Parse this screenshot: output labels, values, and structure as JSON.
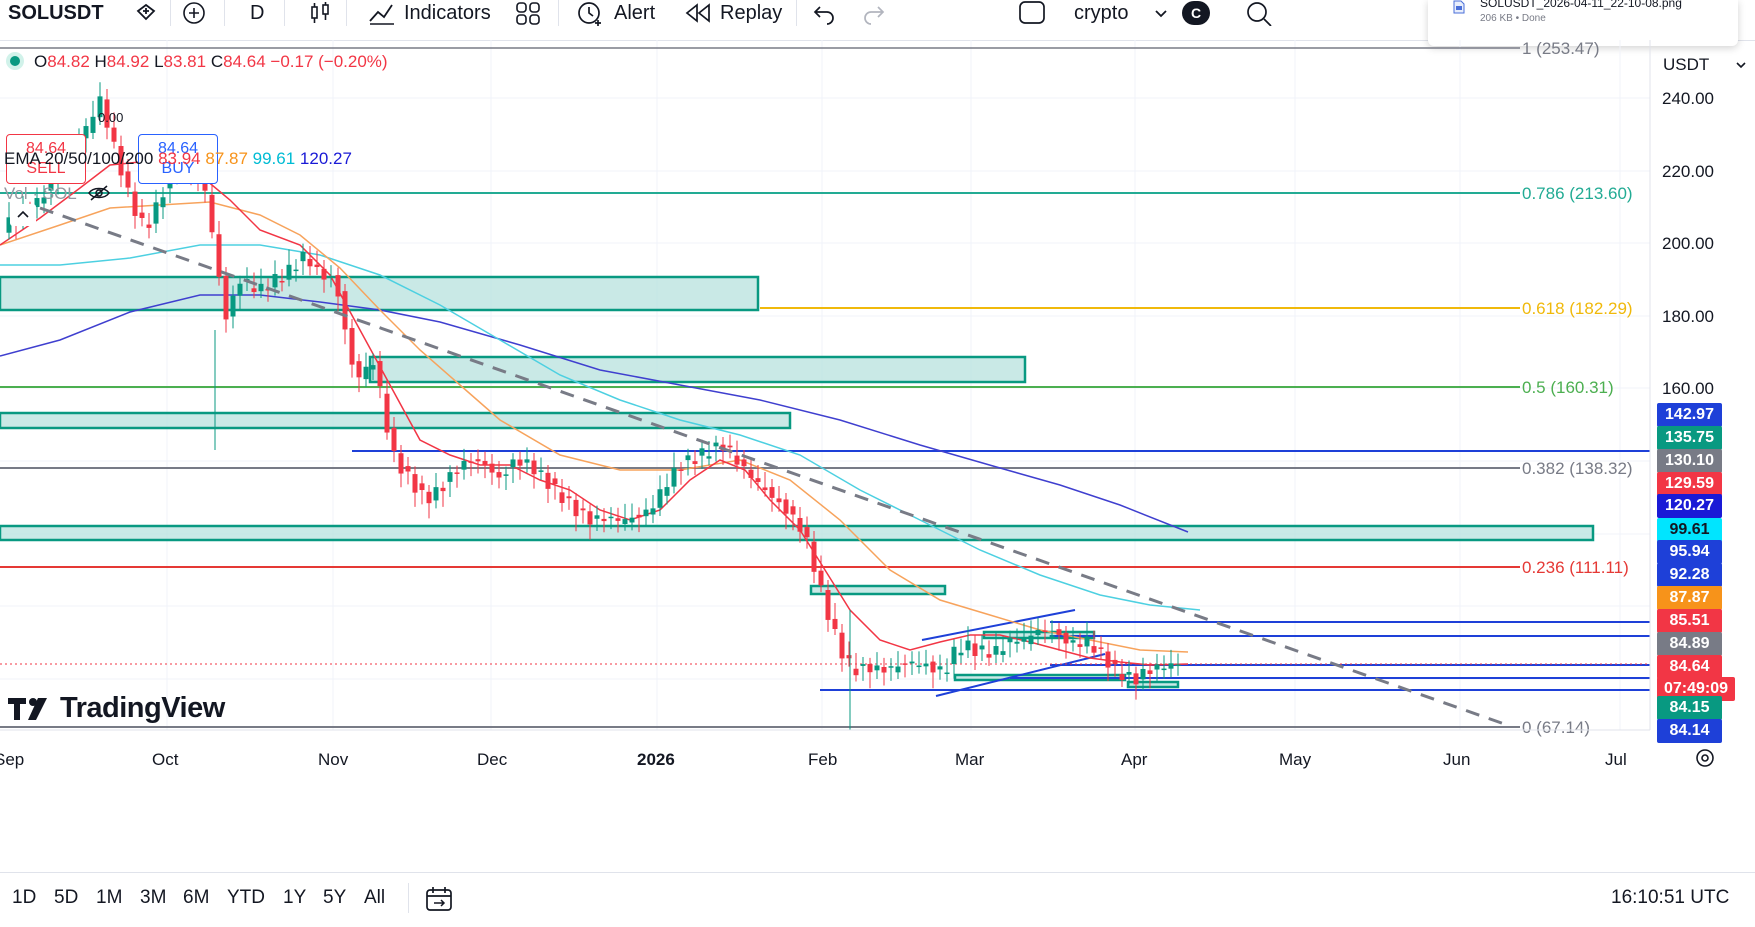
{
  "header": {
    "symbol": "SOLUSDT",
    "interval": "D",
    "indicators_label": "Indicators",
    "alert_label": "Alert",
    "replay_label": "Replay",
    "layout_name": "crypto",
    "avatar_letter": "C",
    "download": {
      "filename": "SOLUSDT_2026-04-11_22-10-08.png",
      "status": "206 KB • Done"
    }
  },
  "legend": {
    "dot_color": "#089981",
    "ohlc_o_label": "O",
    "ohlc_o": "84.82",
    "ohlc_h_label": "H",
    "ohlc_h": "84.92",
    "ohlc_l_label": "L",
    "ohlc_l": "83.81",
    "ohlc_c_label": "C",
    "ohlc_c": "84.64",
    "change": "−0.17 (−0.20%)",
    "sell_price": "84.64",
    "sell_label": "SELL",
    "spread": "0.00",
    "buy_price": "84.64",
    "buy_label": "BUY",
    "ema_label": "EMA 20/50/100/200",
    "ema20": "83.94",
    "ema50": "87.87",
    "ema100": "99.61",
    "ema200": "120.27",
    "vol_label": "Vol · SOL"
  },
  "price_axis": {
    "currency": "USDT",
    "ticks": [
      "240.00",
      "220.00",
      "200.00",
      "180.00",
      "160.00"
    ],
    "tags": [
      {
        "value": "142.97",
        "color": "#1e40d8"
      },
      {
        "value": "135.75",
        "color": "#089981"
      },
      {
        "value": "130.10",
        "color": "#787b86"
      },
      {
        "value": "129.59",
        "color": "#f23645"
      },
      {
        "value": "120.27",
        "color": "#1a1ad6"
      },
      {
        "value": "99.61",
        "color": "#00e5ff",
        "text_color": "#131722"
      },
      {
        "value": "95.94",
        "color": "#1e40d8"
      },
      {
        "value": "92.28",
        "color": "#1e40d8"
      },
      {
        "value": "87.87",
        "color": "#f7931a"
      },
      {
        "value": "85.51",
        "color": "#f23645"
      },
      {
        "value": "84.89",
        "color": "#787b86"
      },
      {
        "value": "84.64",
        "color": "#f23645"
      },
      {
        "value": "07:49:09",
        "color": "#f23645"
      },
      {
        "value": "84.15",
        "color": "#089981"
      },
      {
        "value": "84.14",
        "color": "#1e40d8"
      }
    ]
  },
  "fib": [
    {
      "label": "1 (253.47)",
      "color": "#787b86"
    },
    {
      "label": "0.786 (213.60)",
      "color": "#22ab94"
    },
    {
      "label": "0.618 (182.29)",
      "color": "#f0b90b"
    },
    {
      "label": "0.5 (160.31)",
      "color": "#4caf50"
    },
    {
      "label": "0.382 (138.32)",
      "color": "#787b86"
    },
    {
      "label": "0.236 (111.11)",
      "color": "#e53935"
    },
    {
      "label": "0 (67.14)",
      "color": "#787b86"
    }
  ],
  "time_axis": [
    "Sep",
    "Oct",
    "Nov",
    "Dec",
    "2026",
    "Feb",
    "Mar",
    "Apr",
    "May",
    "Jun",
    "Jul"
  ],
  "watermark": "TradingView",
  "ranges": [
    "1D",
    "5D",
    "1M",
    "3M",
    "6M",
    "YTD",
    "1Y",
    "5Y",
    "All"
  ],
  "clock": "16:10:51 UTC"
}
